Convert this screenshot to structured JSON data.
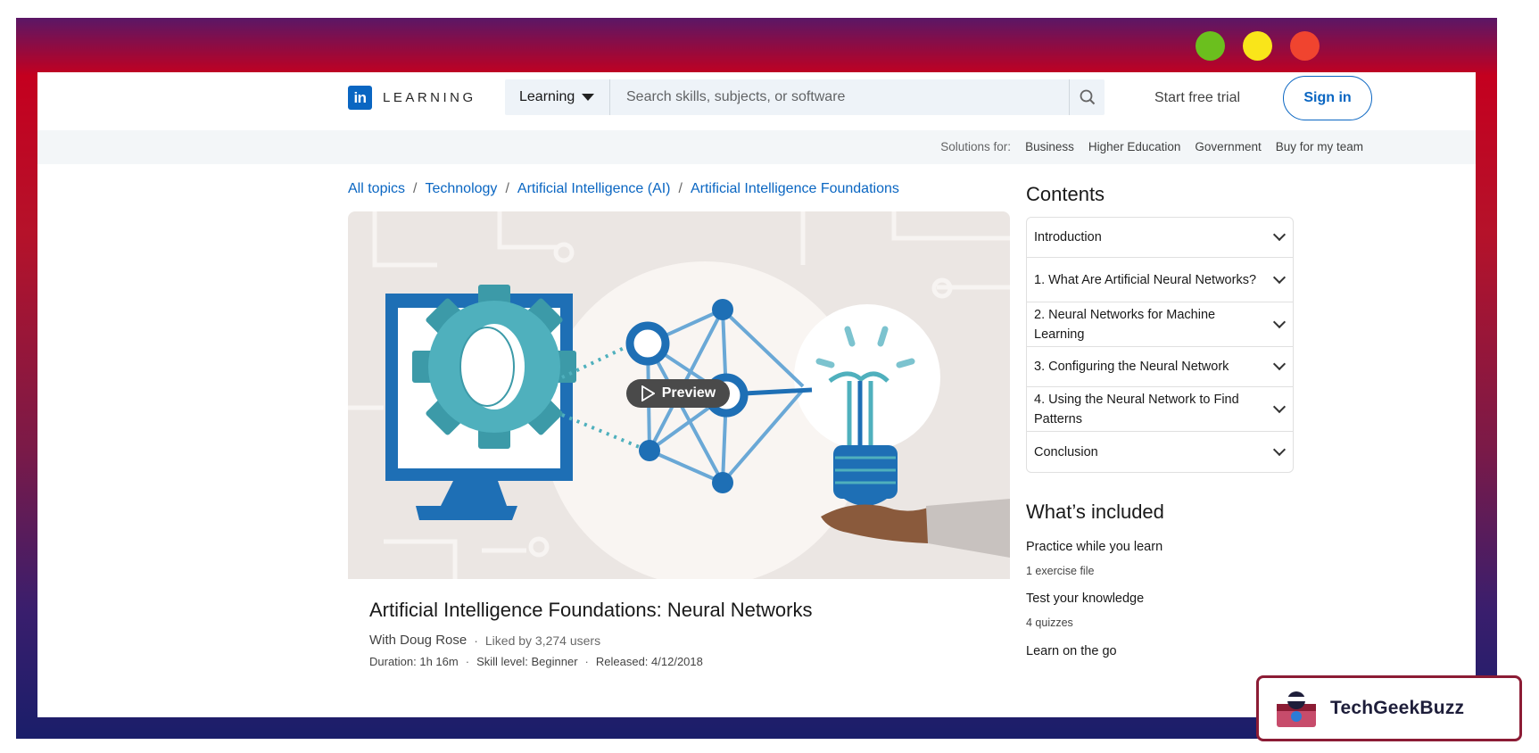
{
  "window": {
    "dot_colors": [
      "#6bbf1e",
      "#f9e51a",
      "#f0442f"
    ]
  },
  "nav": {
    "logo_mark": "in",
    "logo_word": "LEARNING",
    "search_dropdown": "Learning",
    "search_placeholder": "Search skills, subjects, or software",
    "start_trial": "Start free trial",
    "sign_in": "Sign in"
  },
  "solutions": {
    "label": "Solutions for:",
    "items": [
      "Business",
      "Higher Education",
      "Government",
      "Buy for my team"
    ]
  },
  "breadcrumb": {
    "items": [
      "All topics",
      "Technology",
      "Artificial Intelligence (AI)",
      "Artificial Intelligence Foundations"
    ],
    "separator": "/"
  },
  "hero": {
    "preview_label": "Preview"
  },
  "course": {
    "title": "Artificial Intelligence Foundations: Neural Networks",
    "author": "With Doug Rose",
    "likes": "Liked by 3,274 users",
    "duration": "Duration: 1h 16m",
    "skill": "Skill level: Beginner",
    "released": "Released: 4/12/2018",
    "dot": "·"
  },
  "contents": {
    "heading": "Contents",
    "sections": [
      "Introduction",
      "1. What Are Artificial Neural Networks?",
      "2. Neural Networks for Machine Learning",
      "3. Configuring the Neural Network",
      "4. Using the Neural Network to Find Patterns",
      "Conclusion"
    ]
  },
  "included": {
    "heading": "What’s included",
    "items": [
      {
        "title": "Practice while you learn",
        "detail": "1 exercise file"
      },
      {
        "title": "Test your knowledge",
        "detail": "4 quizzes"
      },
      {
        "title": "Learn on the go",
        "detail": ""
      }
    ]
  },
  "watermark": {
    "text": "TechGeekBuzz"
  },
  "colors": {
    "linkedin_blue": "#0a66c2",
    "gear_teal": "#4fb0bd",
    "monitor_blue": "#1e6fb5"
  }
}
